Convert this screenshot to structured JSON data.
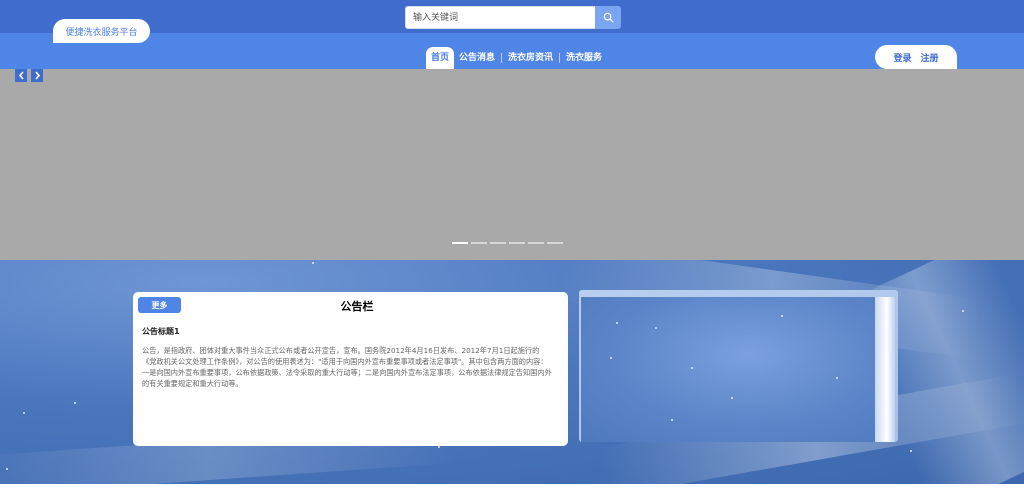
{
  "brand": {
    "title": "便捷洗衣服务平台"
  },
  "search": {
    "placeholder": "输入关键词"
  },
  "nav": {
    "items": [
      {
        "label": "首页",
        "active": true
      },
      {
        "label": "公告消息",
        "active": false
      },
      {
        "label": "洗衣房资讯",
        "active": false
      },
      {
        "label": "洗衣服务",
        "active": false
      }
    ]
  },
  "auth": {
    "login": "登录",
    "register": "注册"
  },
  "carousel": {
    "slide_count": 6,
    "active_index": 0
  },
  "notice": {
    "heading": "公告栏",
    "more": "更多",
    "item_title": "公告标题1",
    "item_body": "公告，是指政府、团体对重大事件当众正式公布或者公开宣告，宣布。国务院2012年4月16日发布、2012年7月1日起施行的《党政机关公文处理工作条例》，对公告的使用表述为：\"适用于向国内外宣布重要事项或者法定事项\"。其中包含两方面的内容：一是向国内外宣布重要事项，公布依据政策、法令采取的重大行动等；二是向国内外宣布法定事项，公布依据法律规定告知国内外的有关重要规定和重大行动等。"
  },
  "colors": {
    "topbar": "#3f6ccd",
    "navbar": "#4f85e6",
    "accent": "#4a7fe0",
    "carousel_bg": "#a9a9a9"
  },
  "icons": {
    "search": "search-icon",
    "prev": "chevron-left-icon",
    "next": "chevron-right-icon"
  }
}
